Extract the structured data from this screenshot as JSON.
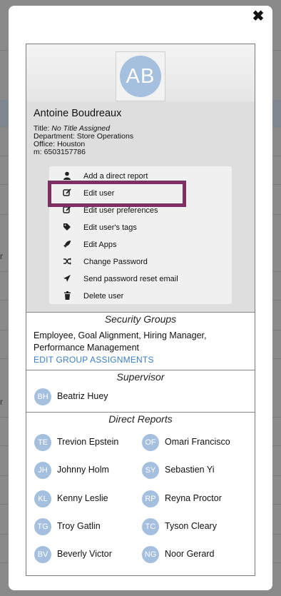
{
  "background": {
    "fragments": [
      "r",
      "r"
    ]
  },
  "modal": {
    "close_glyph": "✖"
  },
  "profile": {
    "initials": "AB",
    "name": "Antoine Boudreaux",
    "title_label": "Title:",
    "title_value": "No Title Assigned",
    "department": "Department: Store Operations",
    "office": "Office: Houston",
    "mobile": "m: 6503157786"
  },
  "menu": {
    "items": [
      {
        "label": "Add a direct report",
        "icon": "person-icon"
      },
      {
        "label": "Edit user",
        "icon": "edit-icon"
      },
      {
        "label": "Edit user preferences",
        "icon": "edit-icon"
      },
      {
        "label": "Edit user's tags",
        "icon": "tags-icon"
      },
      {
        "label": "Edit Apps",
        "icon": "rocket-icon"
      },
      {
        "label": "Change Password",
        "icon": "shuffle-icon"
      },
      {
        "label": "Send password reset email",
        "icon": "send-icon"
      },
      {
        "label": "Delete user",
        "icon": "trash-icon"
      }
    ],
    "highlight_color": "#7c3164"
  },
  "security_groups": {
    "title": "Security Groups",
    "groups_text": "Employee, Goal Alignment, Hiring Manager, Performance Management",
    "edit_link": "EDIT GROUP ASSIGNMENTS"
  },
  "supervisor": {
    "title": "Supervisor",
    "person": {
      "initials": "BH",
      "name": "Beatriz Huey"
    }
  },
  "direct_reports": {
    "title": "Direct Reports",
    "people": [
      {
        "initials": "TE",
        "name": "Trevion Epstein"
      },
      {
        "initials": "OF",
        "name": "Omari Francisco"
      },
      {
        "initials": "JH",
        "name": "Johnny Holm"
      },
      {
        "initials": "SY",
        "name": "Sebastien Yi"
      },
      {
        "initials": "KL",
        "name": "Kenny Leslie"
      },
      {
        "initials": "RP",
        "name": "Reyna Proctor"
      },
      {
        "initials": "TG",
        "name": "Troy Gatlin"
      },
      {
        "initials": "TC",
        "name": "Tyson Cleary"
      },
      {
        "initials": "BV",
        "name": "Beverly Victor"
      },
      {
        "initials": "NG",
        "name": "Noor Gerard"
      }
    ]
  },
  "colors": {
    "avatar": "#a5bfdf",
    "link": "#3b7fc4"
  }
}
